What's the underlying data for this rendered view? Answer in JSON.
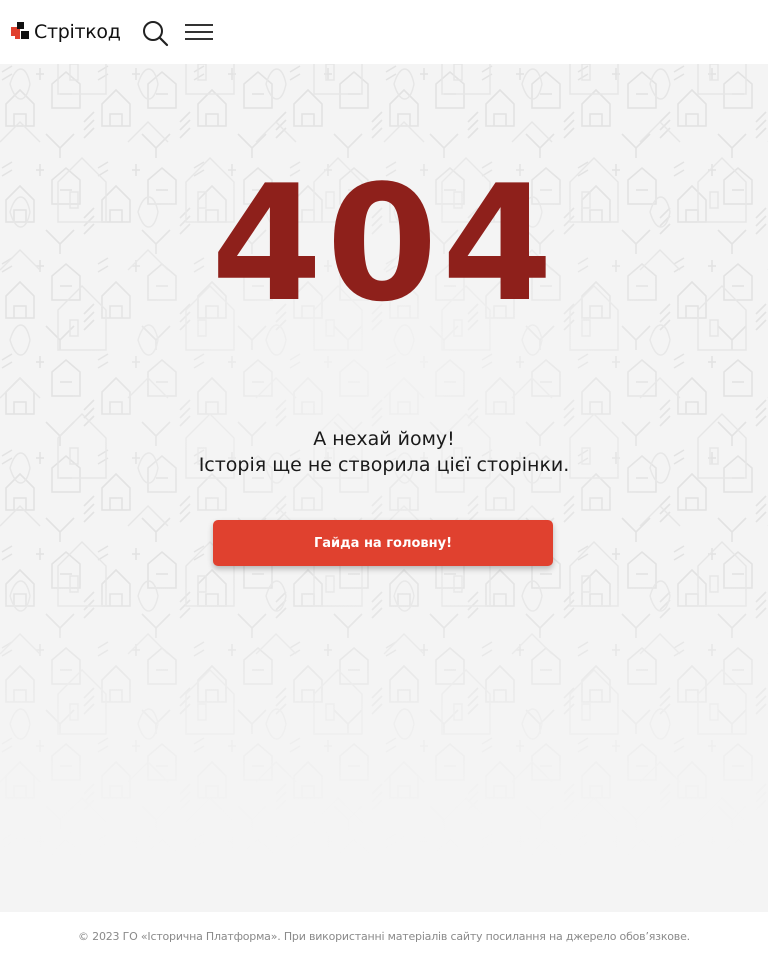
{
  "header": {
    "logo_text": "Стріткод",
    "icons": {
      "search": "search-icon",
      "menu": "hamburger-menu-icon"
    }
  },
  "error": {
    "code": "404",
    "title": "А нехай йому!",
    "subtitle": "Історія ще не створила цієї сторінки.",
    "home_button_label": "Гайда на головну!"
  },
  "footer": {
    "copyright": "© 2023 ГО «Історична Платформа». При використанні матеріалів сайту посилання на джерело обов’язкове."
  },
  "colors": {
    "accent": "#e0412f",
    "error_code": "#8e201b",
    "background": "#f4f4f4",
    "pattern_stroke": "#e3e3e3"
  }
}
